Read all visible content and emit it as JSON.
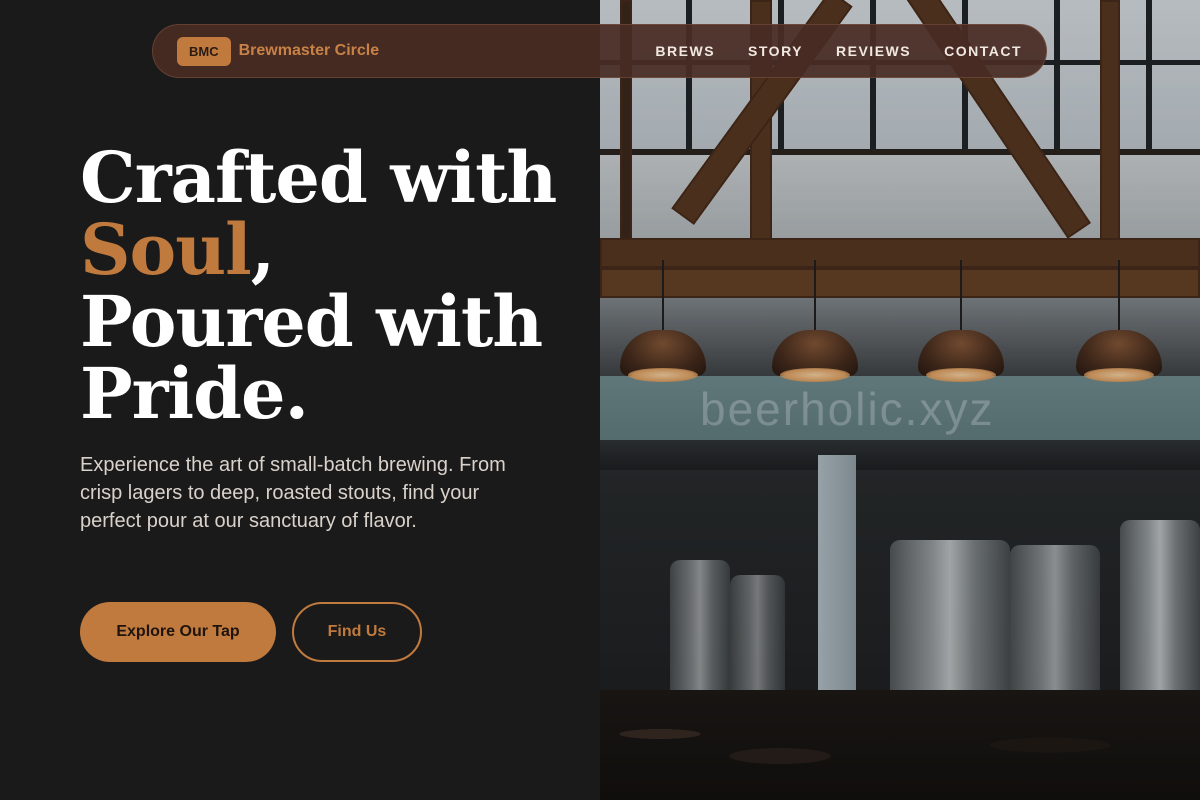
{
  "nav": {
    "brand_badge": "BMC",
    "brand_name": "Brewmaster Circle",
    "links": [
      "BREWS",
      "STORY",
      "REVIEWS",
      "CONTACT"
    ]
  },
  "hero": {
    "title_line1": "Crafted with",
    "title_accent": "Soul",
    "title_comma": ",",
    "title_line3": "Poured with",
    "title_line4": "Pride.",
    "description": "Experience the art of small-batch brewing. From crisp lagers to deep, roasted stouts, find your perfect pour at our sanctuary of flavor.",
    "primary_button": "Explore Our Tap",
    "secondary_button": "Find Us"
  },
  "photo": {
    "watermark": "beerholic.xyz"
  },
  "colors": {
    "background": "#1b1a1a",
    "accent": "#c07a3e",
    "nav_bg": "#482c24",
    "text_light": "#ffffff"
  }
}
